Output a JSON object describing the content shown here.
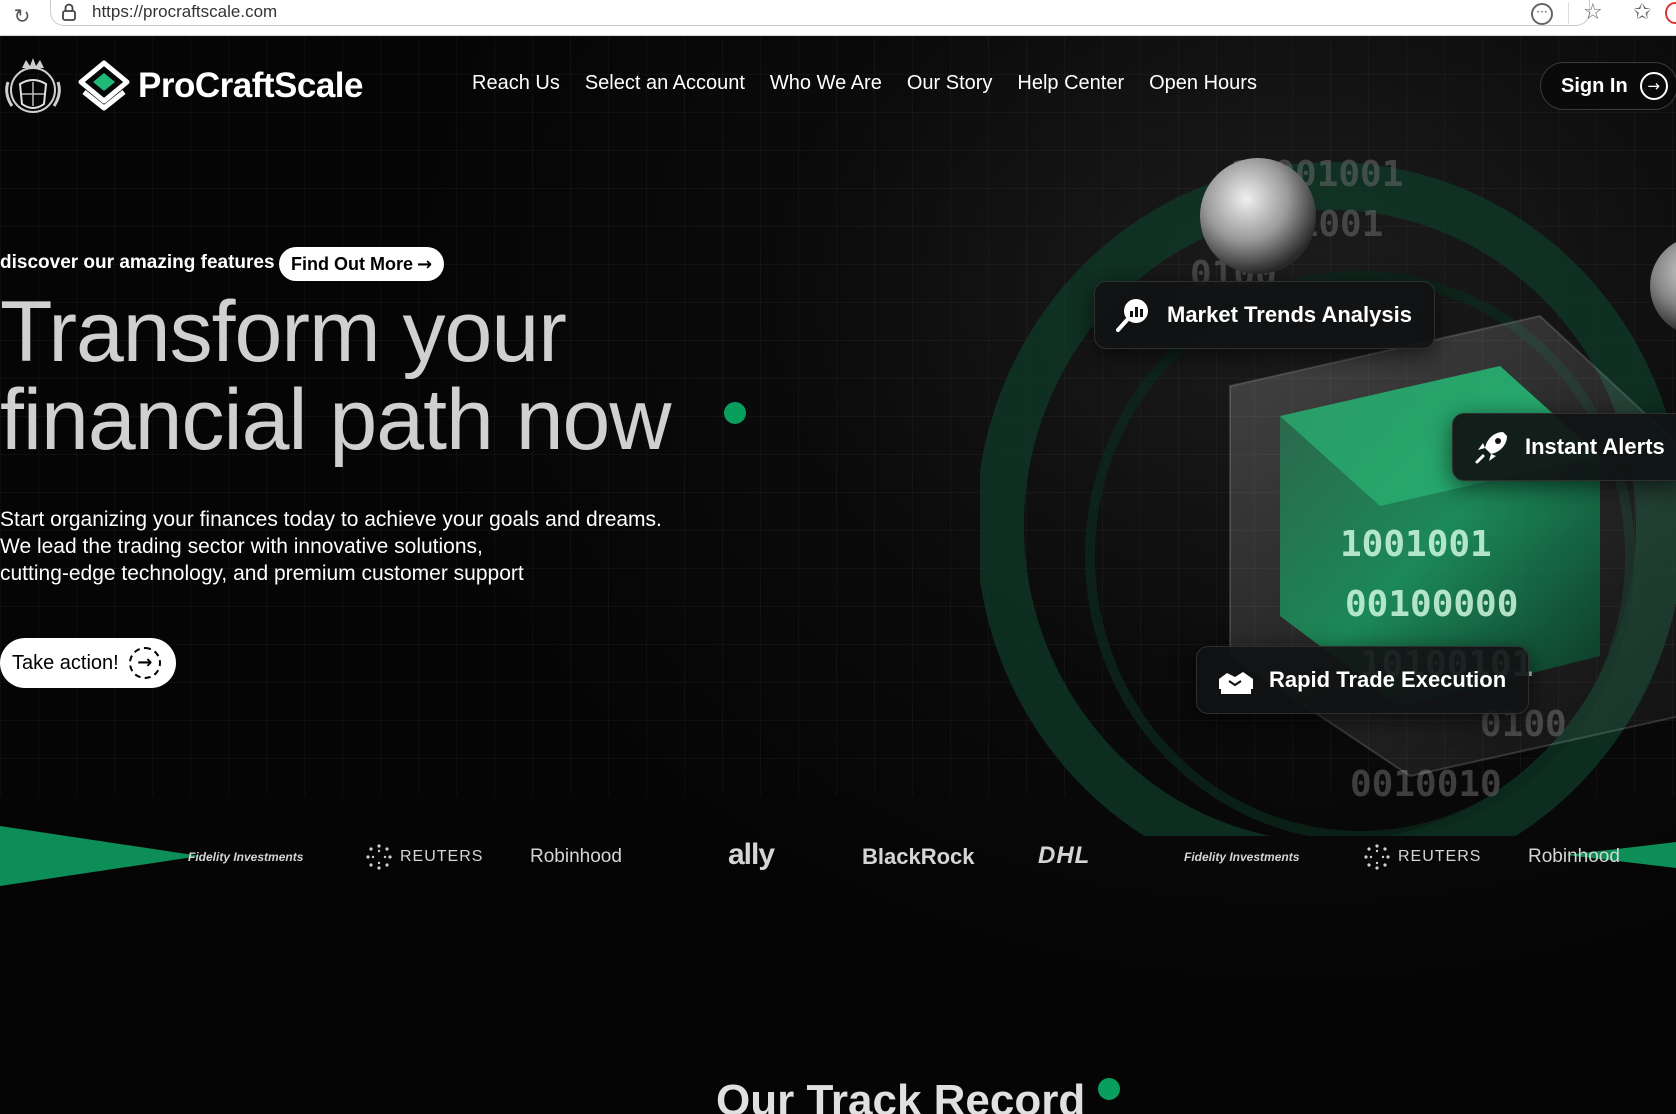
{
  "browser": {
    "url": "https://procraftscale.com"
  },
  "header": {
    "brand": "ProCraftScale",
    "nav": [
      "Reach Us",
      "Select an Account",
      "Who We Are",
      "Our Story",
      "Help Center",
      "Open Hours"
    ],
    "sign_in": "Sign In",
    "sign_in_arrow": "(→)"
  },
  "hero": {
    "eyebrow": "discover our amazing features",
    "find_out": "Find Out More",
    "headline_1": "Transform your",
    "headline_2": "financial path now",
    "lead_1": "Start organizing your finances today to achieve your goals and dreams.",
    "lead_2": "We lead the trading sector with innovative solutions,",
    "lead_3": "cutting-edge technology, and premium customer support",
    "cta": "Take action!"
  },
  "features": [
    {
      "label": "Market Trends Analysis",
      "icon": "magnifier-chart-icon"
    },
    {
      "label": "Instant Alerts",
      "icon": "rocket-icon"
    },
    {
      "label": "Rapid Trade Execution",
      "icon": "handshake-icon"
    }
  ],
  "partners": [
    "Fidelity Investments",
    "REUTERS",
    "Robinhood",
    "ally",
    "BlackRock",
    "DHL",
    "Fidelity Investments",
    "REUTERS",
    "Robinhood"
  ],
  "track": {
    "title": "Our Track Record"
  },
  "colors": {
    "accent": "#0a9e5e",
    "background": "#050505"
  }
}
